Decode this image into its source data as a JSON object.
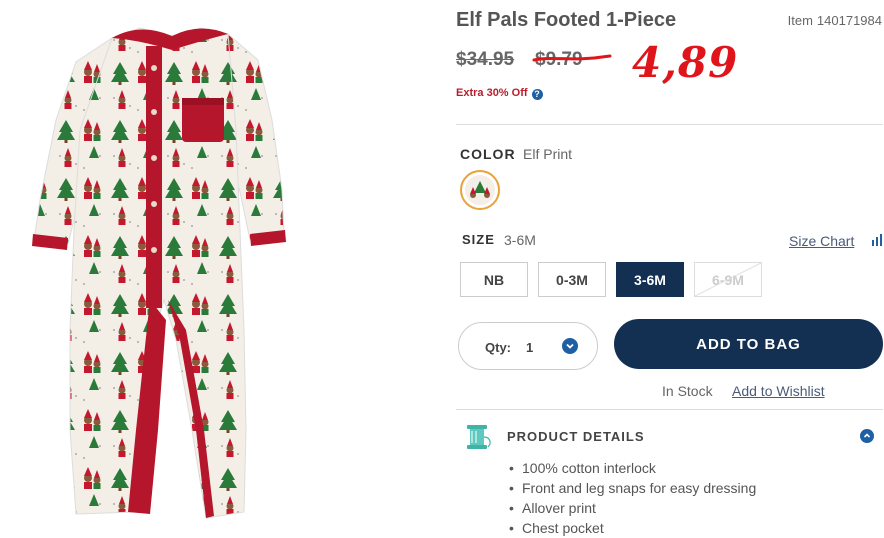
{
  "product": {
    "title": "Elf Pals Footed 1-Piece",
    "item_label": "Item",
    "item_number": "140171984",
    "price_original": "$34.95",
    "price_sale": "$9.79",
    "price_handwritten": "4,89",
    "promo_text": "Extra 30% Off",
    "info_icon": "?"
  },
  "color": {
    "label": "COLOR",
    "value": "Elf Print"
  },
  "size": {
    "label": "SIZE",
    "value": "3-6M",
    "chart_link": "Size Chart",
    "options": [
      {
        "label": "NB",
        "state": "available"
      },
      {
        "label": "0-3M",
        "state": "available"
      },
      {
        "label": "3-6M",
        "state": "selected"
      },
      {
        "label": "6-9M",
        "state": "unavailable"
      }
    ]
  },
  "purchase": {
    "qty_label": "Qty:",
    "qty_value": "1",
    "add_to_bag": "ADD TO BAG",
    "stock_status": "In Stock",
    "wishlist_link": "Add to Wishlist"
  },
  "details": {
    "title": "PRODUCT DETAILS",
    "items": [
      "100% cotton interlock",
      "Front and leg snaps for easy dressing",
      "Allover print",
      "Chest pocket"
    ]
  },
  "colors": {
    "navy": "#132f52",
    "accent_blue": "#1f5fa3",
    "promo_red": "#b81d2b",
    "handwritten_red": "#e0151b",
    "garment_red": "#b5162b",
    "garment_cream": "#f3eee6"
  }
}
